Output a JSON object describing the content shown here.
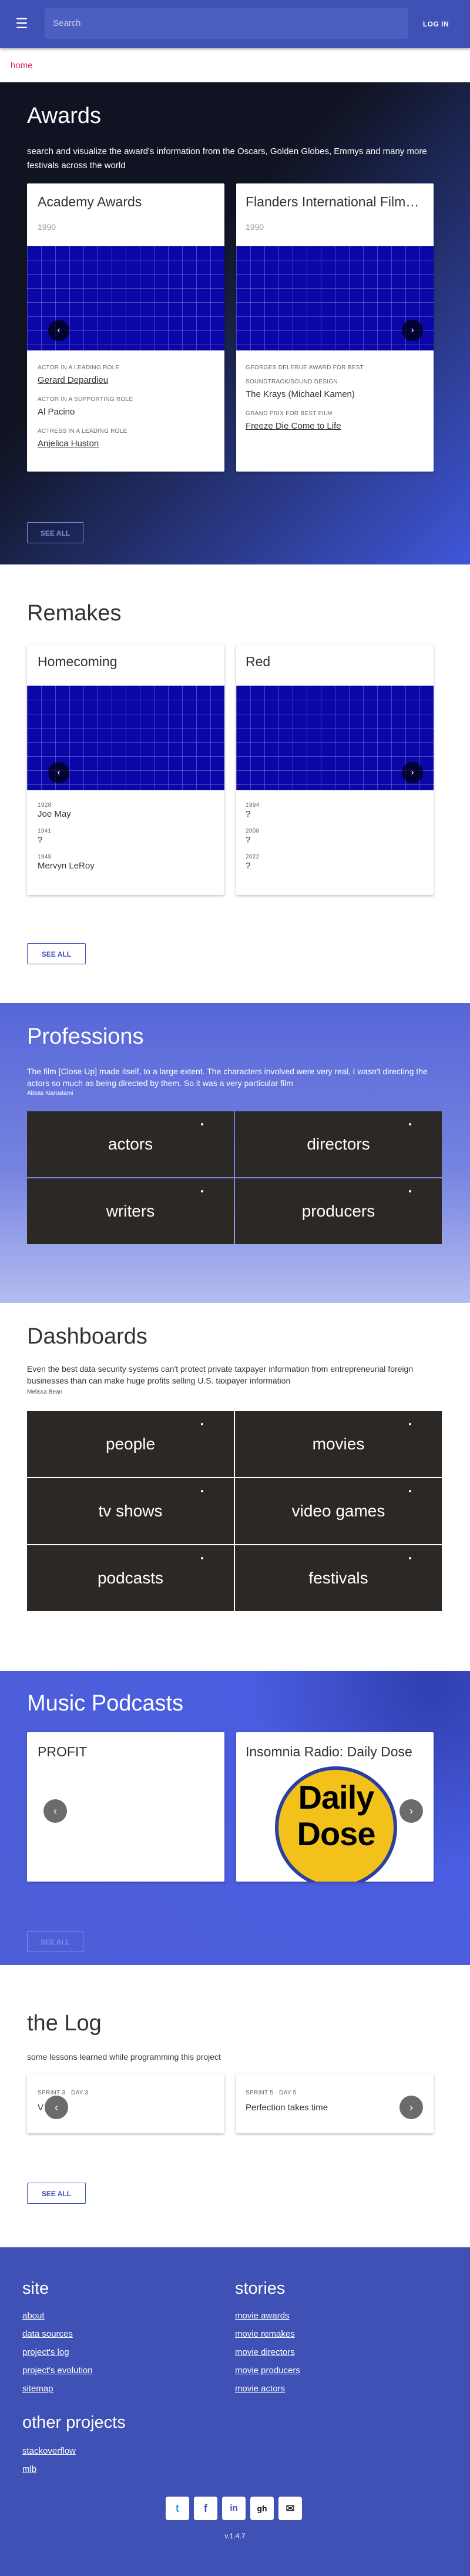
{
  "topbar": {
    "search_placeholder": "Search",
    "login_label": "LOG IN"
  },
  "breadcrumb": {
    "home": "home"
  },
  "awards": {
    "title": "Awards",
    "description": "search and visualize the award's information from the Oscars, Golden Globes, Emmys and many more festivals across the world",
    "see_all": "SEE ALL",
    "cards": [
      {
        "title": "Academy Awards",
        "year": "1990",
        "entries": [
          {
            "category": "ACTOR IN A LEADING ROLE",
            "value": "Gerard Depardieu"
          },
          {
            "category": "ACTOR IN A SUPPORTING ROLE",
            "value": "Al Pacino"
          },
          {
            "category": "ACTRESS IN A LEADING ROLE",
            "value": "Anjelica Huston"
          }
        ]
      },
      {
        "title": "Flanders International Film Festival Ghent",
        "year": "1990",
        "entries": [
          {
            "category": "GEORGES DELERUE AWARD FOR BEST",
            "value": ""
          },
          {
            "category": "SOUNDTRACK/SOUND DESIGN",
            "value": "The Krays (Michael Kamen)"
          },
          {
            "category": "GRAND PRIX FOR BEST FILM",
            "value": "Freeze Die Come to Life"
          }
        ]
      }
    ]
  },
  "remakes": {
    "title": "Remakes",
    "see_all": "SEE ALL",
    "cards": [
      {
        "title": "Homecoming",
        "entries": [
          {
            "year": "1928",
            "value": "Joe May"
          },
          {
            "year": "1941",
            "value": "?"
          },
          {
            "year": "1948",
            "value": "Mervyn LeRoy"
          }
        ]
      },
      {
        "title": "Red",
        "entries": [
          {
            "year": "1994",
            "value": "?"
          },
          {
            "year": "2008",
            "value": "?"
          },
          {
            "year": "2022",
            "value": "?"
          }
        ]
      }
    ]
  },
  "professions": {
    "title": "Professions",
    "quote": "The film [Close Up] made itself, to a large extent. The characters involved were very real, I wasn't directing the actors so much as being directed by them. So it was a very particular film",
    "author": "Abbas Kiarostami",
    "tiles": [
      "actors",
      "directors",
      "writers",
      "producers"
    ]
  },
  "dashboards": {
    "title": "Dashboards",
    "quote": "Even the best data security systems can't protect private taxpayer information from entrepreneurial foreign businesses than can make huge profits selling U.S. taxpayer information",
    "author": "Melissa Bean",
    "tiles": [
      "people",
      "movies",
      "tv shows",
      "video games",
      "podcasts",
      "festivals"
    ]
  },
  "podcasts": {
    "title": "Music Podcasts",
    "see_all": "SEE ALL",
    "cards": [
      {
        "title": "PROFIT"
      },
      {
        "title": "Insomnia Radio: Daily Dose",
        "logo_text": [
          "Daily",
          "Dose"
        ]
      }
    ]
  },
  "log": {
    "title": "the Log",
    "subtitle": "some lessons learned while programming this project",
    "see_all": "SEE ALL",
    "cards": [
      {
        "meta": "SPRINT 3 · DAY 3",
        "value": "V"
      },
      {
        "meta": "SPRINT 5 · DAY 5",
        "value": "Perfection takes time"
      }
    ]
  },
  "footer": {
    "site_title": "site",
    "site_links": [
      "about",
      "data sources",
      "project's log",
      "project's evolution",
      "sitemap"
    ],
    "stories_title": "stories",
    "stories_links": [
      "movie awards",
      "movie remakes",
      "movie directors",
      "movie producers",
      "movie actors"
    ],
    "other_title": "other projects",
    "other_links": [
      "stackoverflow",
      "mlb"
    ],
    "social": [
      "t",
      "f",
      "in",
      "gh",
      "✉"
    ],
    "version": "v.1.4.7"
  },
  "colors": {
    "primary": "#3f51b5",
    "accent": "#e91e63",
    "tile": "#2b2826"
  }
}
